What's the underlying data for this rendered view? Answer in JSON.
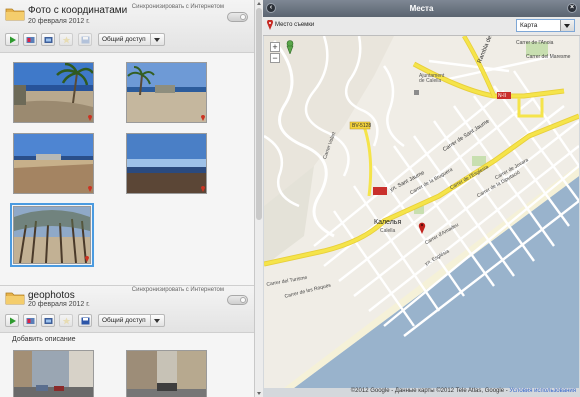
{
  "left": {
    "albums": [
      {
        "title": "Фото с координатами",
        "date": "20 февраля 2012 г.",
        "sync_label": "Синхронизировать с Интернетом",
        "share_label": "Общий доступ"
      },
      {
        "title": "geophotos",
        "date": "20 февраля 2012 г.",
        "sync_label": "Синхронизировать с Интернетом",
        "share_label": "Общий доступ",
        "add_description": "Добавить описание"
      }
    ],
    "toolbar_icons": [
      "play-icon",
      "slideshow-icon",
      "movie-icon",
      "star-icon",
      "save-icon"
    ]
  },
  "right": {
    "window_title": "Места",
    "place_label": "Место съемки",
    "map_type_selected": "Карта",
    "copyright": "©2012 Google - Данные карты ©2012 Tele Atlas, Google -",
    "terms_link": "Условия использования",
    "map_labels": {
      "rambla": "Rambla dels Fra...",
      "nacional": "N-II",
      "bv": "BV-5128",
      "sant_jaume": "Carrer de Sant Jaume",
      "sant_jaume2": "ул. Sant Jaume",
      "calella": "Калелья",
      "calella_sub": "Calella",
      "ajuntament": "Ajuntament de Calella",
      "anoia": "Carrer de l'Anoia",
      "maresme": "Carrer del Maresme",
      "bruguera": "Carrer de la Bruguera",
      "esglesia": "Carrer de l'Esglesia",
      "jovara": "Carrer de Jovara",
      "turisme": "Carrer del Turisme",
      "roques": "Carrer de les Roques",
      "amadeu": "Carrer d'Amadeu",
      "diputacio": "Carrer de la Diputació",
      "volart": "Carrer Volart",
      "iglesia_rd": "ул. Església"
    }
  },
  "colors": {
    "accent": "#4b9be0",
    "sea": "#99b3cc",
    "road_main": "#f5e44a",
    "title_bar": "#636c78"
  }
}
